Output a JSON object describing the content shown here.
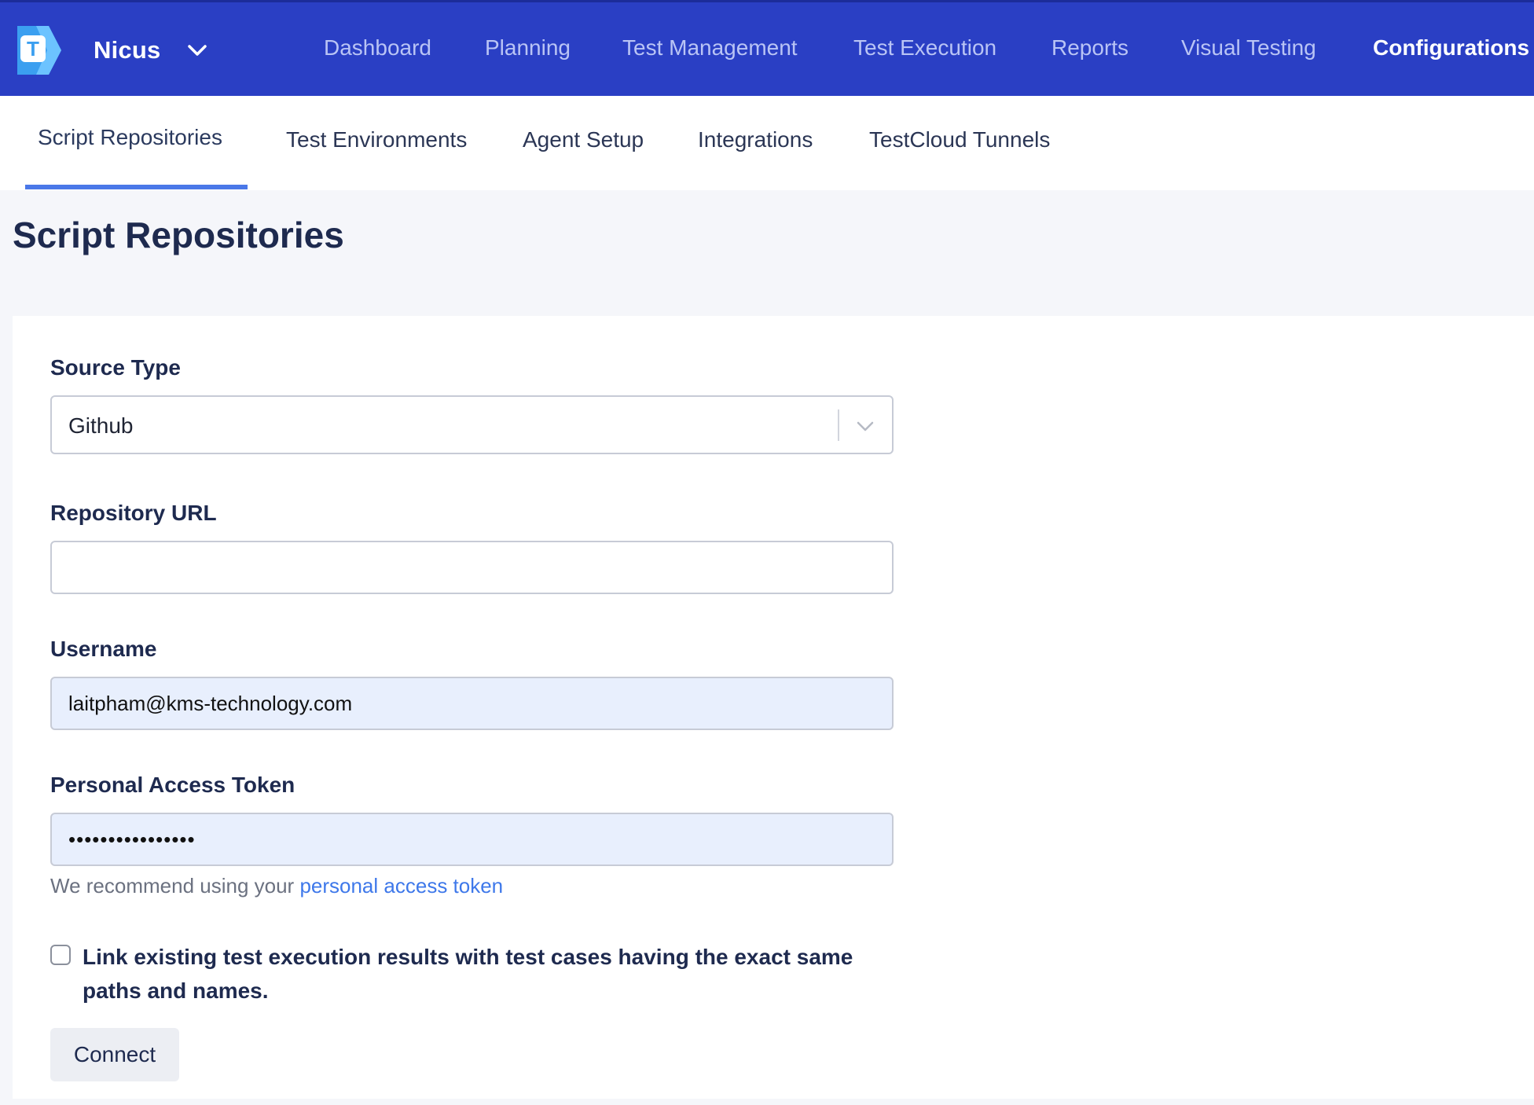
{
  "app": {
    "workspace_name": "Nicus",
    "logo_letter": "T"
  },
  "nav": {
    "items": [
      {
        "label": "Dashboard"
      },
      {
        "label": "Planning"
      },
      {
        "label": "Test Management"
      },
      {
        "label": "Test Execution"
      },
      {
        "label": "Reports"
      },
      {
        "label": "Visual Testing"
      },
      {
        "label": "Configurations",
        "active": true
      }
    ]
  },
  "subnav": {
    "tabs": [
      {
        "label": "Script Repositories",
        "active": true
      },
      {
        "label": "Test Environments"
      },
      {
        "label": "Agent Setup"
      },
      {
        "label": "Integrations"
      },
      {
        "label": "TestCloud Tunnels"
      }
    ]
  },
  "page": {
    "title": "Script Repositories"
  },
  "form": {
    "source_type": {
      "label": "Source Type",
      "value": "Github"
    },
    "repository_url": {
      "label": "Repository URL",
      "value": "",
      "placeholder": ""
    },
    "username": {
      "label": "Username",
      "value": "laitpham@kms-technology.com"
    },
    "token": {
      "label": "Personal Access Token",
      "value": "••••••••••••••••",
      "hint": "We recommend using your ",
      "hint_link": "personal access token"
    },
    "link_checkbox": {
      "label": "Link existing test execution results with test cases having the exact same paths and names.",
      "checked": false
    },
    "connect_label": "Connect"
  },
  "colors": {
    "topbar": "#2a3fc4",
    "accent": "#4a78e8",
    "link": "#3e78ea",
    "filled_input": "#e8effd"
  }
}
